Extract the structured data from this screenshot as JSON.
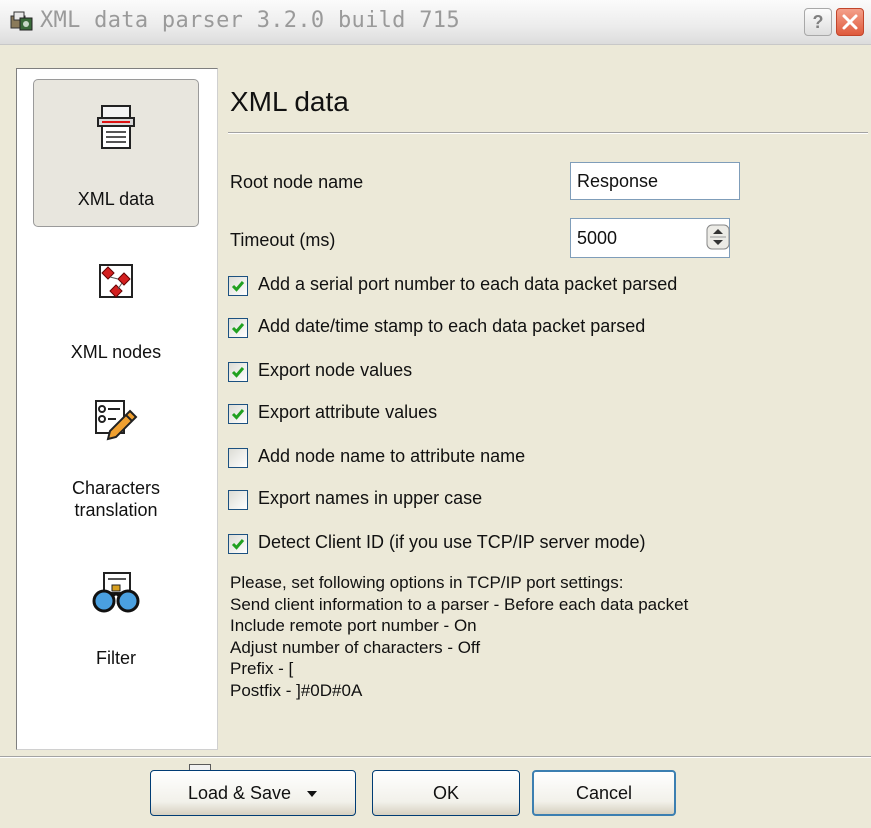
{
  "window": {
    "title": "XML data parser 3.2.0 build 715",
    "help_label": "?"
  },
  "sidebar": {
    "items": [
      {
        "label": "XML data",
        "icon": "printer-document-icon",
        "selected": true
      },
      {
        "label": "XML nodes",
        "icon": "diamond-nodes-icon",
        "selected": false
      },
      {
        "label_line1": "Characters",
        "label_line2": "translation",
        "icon": "list-pencil-icon",
        "selected": false
      },
      {
        "label": "Filter",
        "icon": "glasses-icon",
        "selected": false
      }
    ]
  },
  "main": {
    "title": "XML data",
    "root_node": {
      "label": "Root node name",
      "value": "Response"
    },
    "timeout": {
      "label": "Timeout (ms)",
      "value": "5000"
    },
    "checkboxes": [
      {
        "label": "Add a serial port number to each data packet parsed",
        "checked": true
      },
      {
        "label": "Add date/time stamp to each data packet parsed",
        "checked": true
      },
      {
        "label": "Export node values",
        "checked": true
      },
      {
        "label": "Export attribute values",
        "checked": true
      },
      {
        "label": "Add node name to attribute name",
        "checked": false
      },
      {
        "label": "Export names in upper case",
        "checked": false
      },
      {
        "label": "Detect Client ID (if you use TCP/IP server mode)",
        "checked": true
      }
    ],
    "info_lines": [
      "Please, set following options in TCP/IP port settings:",
      "Send client information to a parser - Before each data packet",
      "Include remote port number - On",
      "Adjust number of characters - Off",
      "Prefix - [",
      "Postfix - ]#0D#0A"
    ]
  },
  "buttons": {
    "load_save": "Load & Save",
    "ok": "OK",
    "cancel": "Cancel"
  },
  "colors": {
    "window_bg": "#ece9d8",
    "checkbox_check": "#21a121",
    "button_border": "#003c74"
  }
}
